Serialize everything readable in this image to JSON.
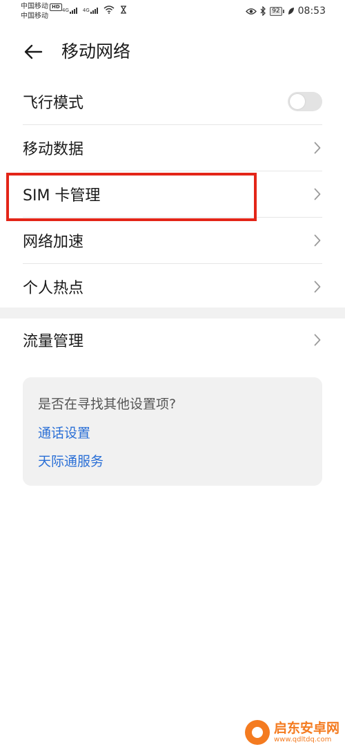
{
  "status_bar": {
    "carrier_1": "中国移动",
    "hd_badge": "HD",
    "carrier_2": "中国移动",
    "sim1_net": "4G",
    "sim2_net": "4G",
    "battery_level": "92",
    "time": "08:53"
  },
  "header": {
    "title": "移动网络"
  },
  "settings": {
    "items": [
      {
        "label": "飞行模式",
        "control": "toggle",
        "toggle_on": false
      },
      {
        "label": "移动数据",
        "control": "chevron"
      },
      {
        "label": "SIM 卡管理",
        "control": "chevron"
      },
      {
        "label": "网络加速",
        "control": "chevron"
      },
      {
        "label": "个人热点",
        "control": "chevron"
      }
    ],
    "section2": [
      {
        "label": "流量管理",
        "control": "chevron"
      }
    ]
  },
  "suggestion": {
    "title": "是否在寻找其他设置项?",
    "links": [
      "通话设置",
      "天际通服务"
    ]
  },
  "colors": {
    "highlight": "#e32518",
    "link": "#2a6fd6",
    "watermark": "#f47b20"
  },
  "watermark": {
    "name": "启东安卓网",
    "url": "www.qdltdq.com"
  }
}
